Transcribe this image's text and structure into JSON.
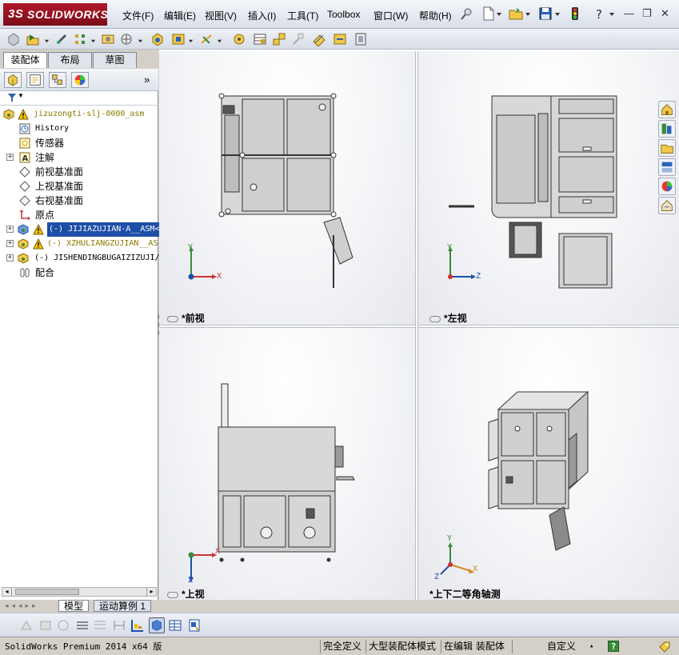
{
  "app": {
    "logo_prefix": "3S",
    "logo_text": "SOLIDWORKS"
  },
  "menu": {
    "items": [
      {
        "label": "文件(F)"
      },
      {
        "label": "编辑(E)"
      },
      {
        "label": "视图(V)"
      },
      {
        "label": "插入(I)"
      },
      {
        "label": "工具(T)"
      },
      {
        "label": "Toolbox"
      },
      {
        "label": "窗口(W)"
      },
      {
        "label": "帮助(H)"
      }
    ]
  },
  "window_controls": {
    "minimize": "—",
    "restore": "❐",
    "close": "✕"
  },
  "panel": {
    "tabs": [
      "装配体",
      "布局",
      "草图"
    ],
    "expand_arrow": "»",
    "filter_icon": "▼"
  },
  "tree": {
    "root": "jizuzongti-slj-0000_asm",
    "items": [
      {
        "label": "History"
      },
      {
        "label": "传感器"
      },
      {
        "label": "注解"
      },
      {
        "label": "前视基准面"
      },
      {
        "label": "上视基准面"
      },
      {
        "label": "右视基准面"
      },
      {
        "label": "原点"
      },
      {
        "label": "(-) JIJIAZUJIAN-A__ASM<"
      },
      {
        "label": "(-) XZHULIANGZUJIAN__AS"
      },
      {
        "label": "(-) JISHENDINGBUGAIZIZUJI/"
      },
      {
        "label": "配合"
      }
    ]
  },
  "viewports": {
    "front": "*前视",
    "left": "*左视",
    "top": "*上视",
    "iso": "*上下二等角轴测"
  },
  "axes": {
    "front": {
      "v": "Y",
      "h": "X"
    },
    "left": {
      "v": "Y",
      "h": "Z"
    },
    "top": {
      "v": "Z",
      "h": "X"
    },
    "iso": {
      "v": "Y",
      "h": "X",
      "d": "Z"
    }
  },
  "bottom_tabs": {
    "model": "模型",
    "motion": "运动算例 1"
  },
  "status": {
    "product": "SolidWorks Premium 2014 x64 版",
    "defined": "完全定义",
    "mode": "大型装配体模式",
    "editing": "在编辑 装配体",
    "custom": "自定义",
    "help": "?"
  },
  "colors": {
    "brand_red": "#a01523",
    "accent_blue": "#1e4fa8",
    "warning_yellow": "#f2c200"
  }
}
